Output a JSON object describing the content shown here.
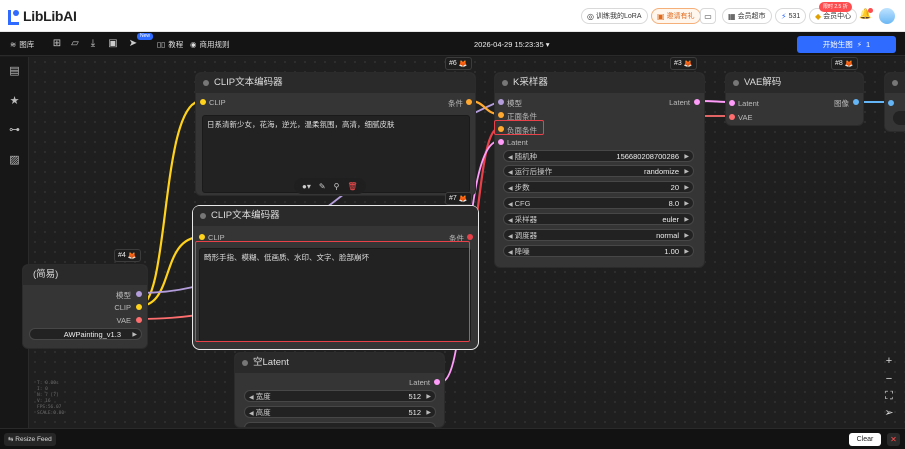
{
  "app": {
    "logo_text": "LibLibAI",
    "train_lora": "训练我的LoRA",
    "invite": "邀请有礼",
    "member_super": "会员超市",
    "points": "531",
    "member_center": "会员中心",
    "new_badge": "限时 2.5 折"
  },
  "toolbar": {
    "gallery": "图库",
    "new_badge": "New",
    "tutorial": "教程",
    "commercial_rules": "商用规则",
    "datetime": "2026-04-29 15:23:35",
    "generate_label": "开始生图",
    "generate_cost": "1"
  },
  "nodes": {
    "clip_encoder_pos": {
      "id": "#6",
      "title": "CLIP文本编码器",
      "in_clip": "CLIP",
      "out_cond": "条件",
      "text": "日系清新少女，花海，逆光，温柔氛围，高清，细腻皮肤"
    },
    "clip_encoder_neg": {
      "id": "#7",
      "title": "CLIP文本编码器",
      "in_clip": "CLIP",
      "out_cond": "条件",
      "text": "畸形手指、模糊、低画质、水印、文字、脸部崩坏"
    },
    "ksampler": {
      "id": "#3",
      "title": "K采样器",
      "in_model": "模型",
      "in_pos": "正面条件",
      "in_neg": "负面条件",
      "in_latent": "Latent",
      "out_latent": "Latent",
      "widgets": [
        {
          "label": "随机种",
          "value": "156680208700286"
        },
        {
          "label": "运行后操作",
          "value": "randomize"
        },
        {
          "label": "步数",
          "value": "20"
        },
        {
          "label": "CFG",
          "value": "8.0"
        },
        {
          "label": "采样器",
          "value": "euler"
        },
        {
          "label": "调度器",
          "value": "normal"
        },
        {
          "label": "降噪",
          "value": "1.00"
        }
      ]
    },
    "vae_decode": {
      "id": "#8",
      "title": "VAE解码",
      "in_latent": "Latent",
      "in_vae": "VAE",
      "out_image": "图像"
    },
    "checkpoint": {
      "id": "#4",
      "title": "(简易)",
      "out_model": "模型",
      "out_clip": "CLIP",
      "out_vae": "VAE",
      "model_value": "AWPainting_v1.3"
    },
    "empty_latent": {
      "title": "空Latent",
      "out_latent": "Latent",
      "widgets": [
        {
          "label": "宽度",
          "value": "512"
        },
        {
          "label": "高度",
          "value": "512"
        }
      ]
    }
  },
  "info_lines": [
    "T: 0.00s",
    "I: 0",
    "N: 7 [7]",
    "V: 16",
    "FPS:56.07",
    "SCALE:0.80"
  ],
  "bottom": {
    "resize_feed": "Resize Feed",
    "clear": "Clear"
  },
  "colors": {
    "accent": "#2f6bff",
    "highlight": "#e8414a",
    "wire_clip": "#ffd21c",
    "wire_model": "#b39ddb",
    "wire_cond": "#ffa931",
    "wire_latent": "#ff9cf9",
    "wire_vae": "#ff6e6e",
    "wire_image": "#64b5f6"
  }
}
